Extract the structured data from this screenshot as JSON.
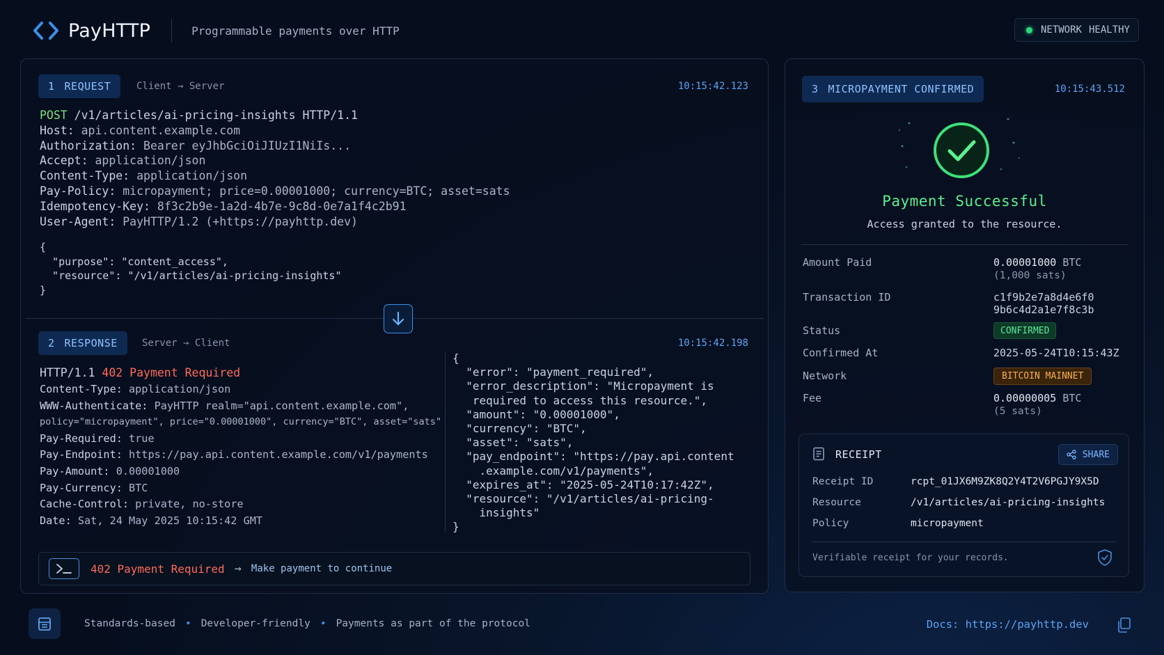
{
  "header": {
    "brand": "PayHTTP",
    "tagline": "Programmable payments over HTTP",
    "network_status": {
      "label": "NETWORK",
      "value": "HEALTHY",
      "color": "#2ed47a"
    }
  },
  "request": {
    "step": "1",
    "label": "REQUEST",
    "route": "Client → Server",
    "timestamp": "10:15:42.123",
    "method": "POST",
    "path_line": " /v1/articles/ai-pricing-insights HTTP/1.1",
    "headers": [
      {
        "k": "Host:",
        "v": " api.content.example.com"
      },
      {
        "k": "Authorization:",
        "v": " Bearer eyJhbGciOiJIUzI1NiIs..."
      },
      {
        "k": "Accept:",
        "v": " application/json"
      },
      {
        "k": "Content-Type:",
        "v": " application/json"
      },
      {
        "k": "Pay-Policy:",
        "v": " micropayment; price=0.00001000; currency=BTC; asset=sats"
      },
      {
        "k": "Idempotency-Key:",
        "v": " 8f3c2b9e-1a2d-4b7e-9c8d-0e7a1f4c2b91"
      },
      {
        "k": "User-Agent:",
        "v": " PayHTTP/1.2 (+https://payhttp.dev)"
      }
    ],
    "body_lines": [
      "{",
      "  \"purpose\": \"content_access\",",
      "  \"resource\": \"/v1/articles/ai-pricing-insights\"",
      "}"
    ]
  },
  "response": {
    "step": "2",
    "label": "RESPONSE",
    "route": "Server → Client",
    "timestamp": "10:15:42.198",
    "status_prefix": "HTTP/1.1 ",
    "status": "402 Payment Required",
    "headers": [
      {
        "k": "Content-Type:",
        "v": " application/json"
      },
      {
        "k": "WWW-Authenticate:",
        "v": " PayHTTP realm=\"api.content.example.com\","
      },
      {
        "k": "",
        "v": "policy=\"micropayment\", price=\"0.00001000\", currency=\"BTC\", asset=\"sats\""
      },
      {
        "k": "Pay-Required:",
        "v": " true"
      },
      {
        "k": "Pay-Endpoint:",
        "v": " https://pay.api.content.example.com/v1/payments"
      },
      {
        "k": "Pay-Amount:",
        "v": " 0.00001000"
      },
      {
        "k": "Pay-Currency:",
        "v": " BTC"
      },
      {
        "k": "Cache-Control:",
        "v": " private, no-store"
      },
      {
        "k": "Date:",
        "v": " Sat, 24 May 2025 10:15:42 GMT"
      }
    ],
    "json_lines": [
      "{",
      "  \"error\": \"payment_required\",",
      "  \"error_description\": \"Micropayment is",
      "   required to access this resource.\",",
      "  \"amount\": \"0.00001000\",",
      "  \"currency\": \"BTC\",",
      "  \"asset\": \"sats\",",
      "  \"pay_endpoint\": \"https://pay.api.content",
      "    .example.com/v1/payments\",",
      "  \"expires_at\": \"2025-05-24T10:17:42Z\",",
      "  \"resource\": \"/v1/articles/ai-pricing-",
      "    insights\"",
      "}"
    ],
    "cmd": {
      "status": "402 Payment Required",
      "arrow": "→",
      "hint": "Make payment to continue"
    }
  },
  "confirmation": {
    "step": "3",
    "label": "MICROPAYMENT CONFIRMED",
    "timestamp": "10:15:43.512",
    "title": "Payment Successful",
    "subtitle": "Access granted to the resource.",
    "amount_paid": {
      "label": "Amount Paid",
      "value": "0.00001000",
      "unit": " BTC",
      "sub": "(1,000 sats)"
    },
    "transaction_id": {
      "label": "Transaction ID",
      "line1": "c1f9b2e7a8d4e6f0",
      "line2": "9b6c4d2a1e7f8c3b"
    },
    "status": {
      "label": "Status",
      "value": "CONFIRMED"
    },
    "confirmed_at": {
      "label": "Confirmed At",
      "value": "2025-05-24T10:15:43Z"
    },
    "network": {
      "label": "Network",
      "value": "BITCOIN MAINNET"
    },
    "fee": {
      "label": "Fee",
      "value": "0.00000005",
      "unit": " BTC",
      "sub": "(5 sats)"
    }
  },
  "receipt": {
    "title": "RECEIPT",
    "share_label": "SHARE",
    "rows": [
      {
        "label": "Receipt ID",
        "value": "rcpt_01JX6M9ZK8Q2Y4T2V6PGJY9X5D"
      },
      {
        "label": "Resource",
        "value": "/v1/articles/ai-pricing-insights"
      },
      {
        "label": "Policy",
        "value": "micropayment"
      }
    ],
    "footer": "Verifiable receipt for your records."
  },
  "footer": {
    "items": [
      "Standards-based",
      "Developer-friendly",
      "Payments as part of the protocol"
    ],
    "separator": "•",
    "docs": "Docs: https://payhttp.dev"
  },
  "colors": {
    "accent": "#3a8fe8",
    "success": "#5cf08e",
    "error": "#ff6a5a",
    "warning": "#f5ae54"
  },
  "icons": [
    "chevrons-code-icon",
    "arrow-down-icon",
    "terminal-icon",
    "check-circle-icon",
    "receipt-icon",
    "share-icon",
    "shield-check-icon",
    "document-stack-icon",
    "copy-icon"
  ]
}
